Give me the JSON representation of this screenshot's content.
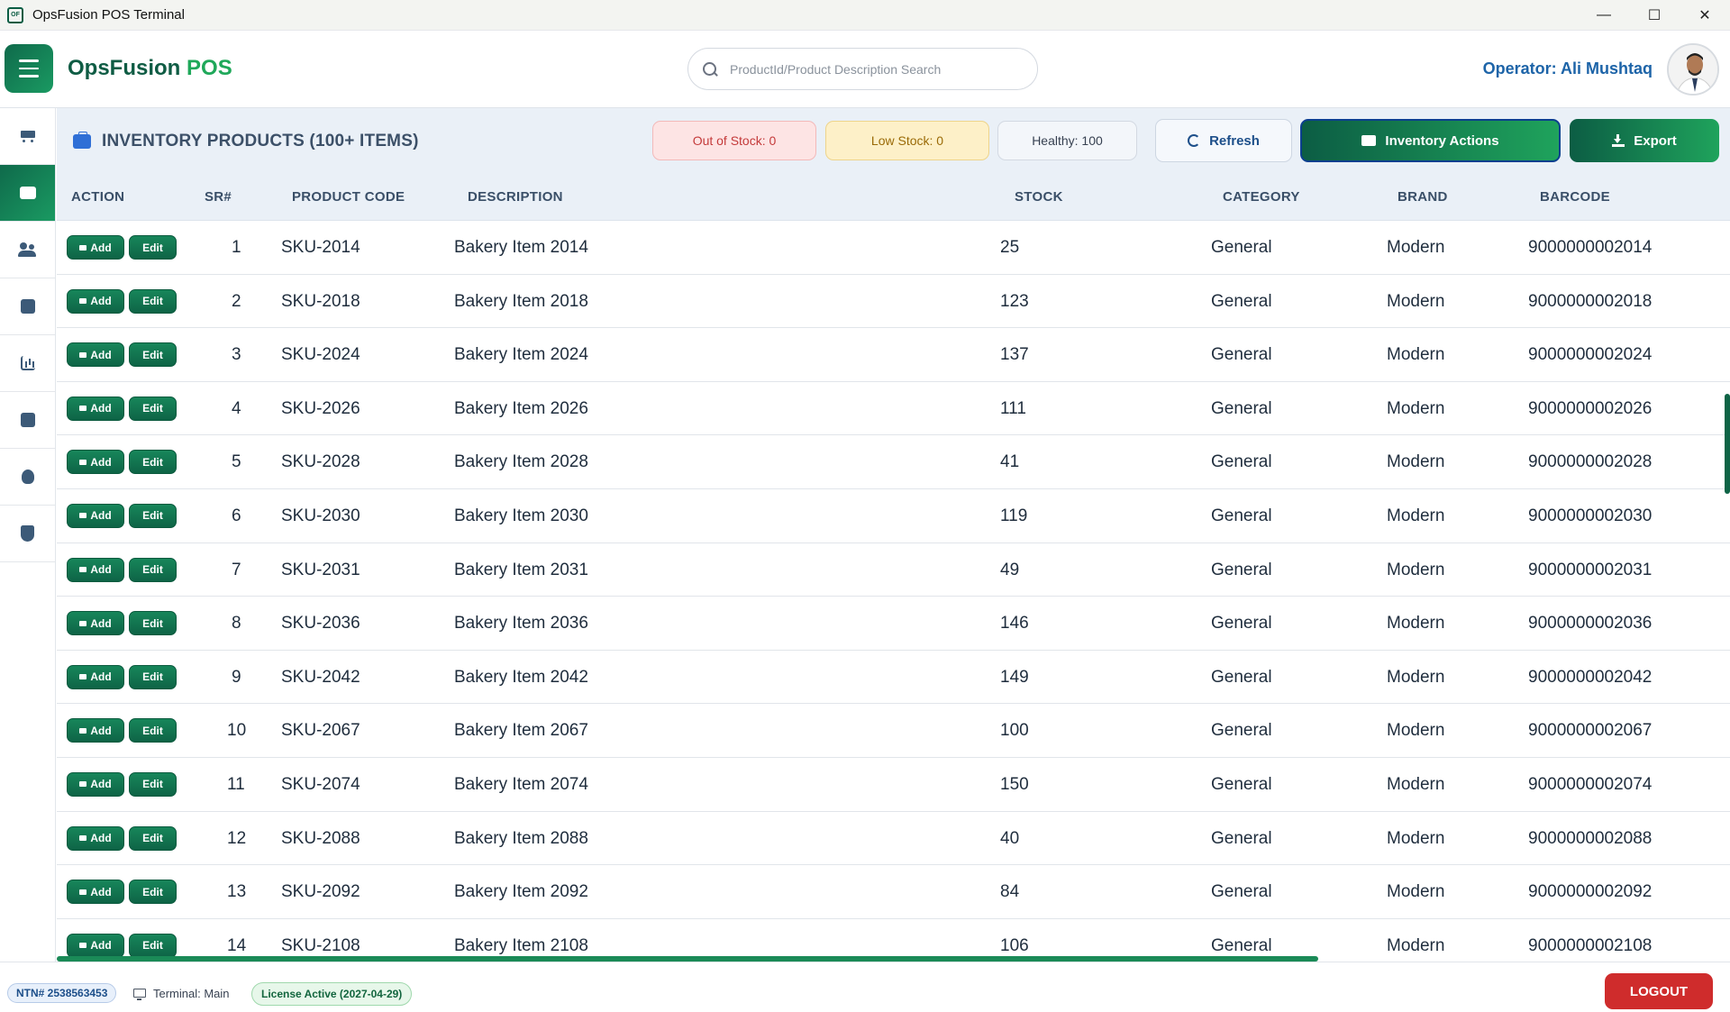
{
  "window": {
    "title": "OpsFusion POS Terminal",
    "icon_text": "OF"
  },
  "header": {
    "brand_main": "OpsFusion",
    "brand_accent": "POS",
    "search_placeholder": "ProductId/Product Description Search",
    "search_value": "",
    "operator": "Operator: Ali Mushtaq"
  },
  "sidebar": {
    "items": [
      {
        "icon": "cart-icon",
        "active": false
      },
      {
        "icon": "briefcase-icon",
        "active": true
      },
      {
        "icon": "users-icon",
        "active": false
      },
      {
        "icon": "box-icon",
        "active": false
      },
      {
        "icon": "chart-icon",
        "active": false
      },
      {
        "icon": "box-icon",
        "active": false
      },
      {
        "icon": "bulb-icon",
        "active": false
      },
      {
        "icon": "shield-icon",
        "active": false
      }
    ]
  },
  "toolbar": {
    "title": "INVENTORY PRODUCTS (100+ ITEMS)",
    "out_of_stock": "Out of Stock: 0",
    "low_stock": "Low Stock: 0",
    "healthy": "Healthy: 100",
    "refresh_label": "Refresh",
    "inventory_actions_label": "Inventory Actions",
    "export_label": "Export"
  },
  "table": {
    "columns": [
      "ACTION",
      "SR#",
      "PRODUCT CODE",
      "DESCRIPTION",
      "STOCK",
      "CATEGORY",
      "BRAND",
      "BARCODE"
    ],
    "add_label": "Add",
    "edit_label": "Edit",
    "rows": [
      {
        "sr": "1",
        "code": "SKU-2014",
        "desc": "Bakery Item 2014",
        "stock": "25",
        "category": "General",
        "brand": "Modern",
        "barcode": "9000000002014"
      },
      {
        "sr": "2",
        "code": "SKU-2018",
        "desc": "Bakery Item 2018",
        "stock": "123",
        "category": "General",
        "brand": "Modern",
        "barcode": "9000000002018"
      },
      {
        "sr": "3",
        "code": "SKU-2024",
        "desc": "Bakery Item 2024",
        "stock": "137",
        "category": "General",
        "brand": "Modern",
        "barcode": "9000000002024"
      },
      {
        "sr": "4",
        "code": "SKU-2026",
        "desc": "Bakery Item 2026",
        "stock": "111",
        "category": "General",
        "brand": "Modern",
        "barcode": "9000000002026"
      },
      {
        "sr": "5",
        "code": "SKU-2028",
        "desc": "Bakery Item 2028",
        "stock": "41",
        "category": "General",
        "brand": "Modern",
        "barcode": "9000000002028"
      },
      {
        "sr": "6",
        "code": "SKU-2030",
        "desc": "Bakery Item 2030",
        "stock": "119",
        "category": "General",
        "brand": "Modern",
        "barcode": "9000000002030"
      },
      {
        "sr": "7",
        "code": "SKU-2031",
        "desc": "Bakery Item 2031",
        "stock": "49",
        "category": "General",
        "brand": "Modern",
        "barcode": "9000000002031"
      },
      {
        "sr": "8",
        "code": "SKU-2036",
        "desc": "Bakery Item 2036",
        "stock": "146",
        "category": "General",
        "brand": "Modern",
        "barcode": "9000000002036"
      },
      {
        "sr": "9",
        "code": "SKU-2042",
        "desc": "Bakery Item 2042",
        "stock": "149",
        "category": "General",
        "brand": "Modern",
        "barcode": "9000000002042"
      },
      {
        "sr": "10",
        "code": "SKU-2067",
        "desc": "Bakery Item 2067",
        "stock": "100",
        "category": "General",
        "brand": "Modern",
        "barcode": "9000000002067"
      },
      {
        "sr": "11",
        "code": "SKU-2074",
        "desc": "Bakery Item 2074",
        "stock": "150",
        "category": "General",
        "brand": "Modern",
        "barcode": "9000000002074"
      },
      {
        "sr": "12",
        "code": "SKU-2088",
        "desc": "Bakery Item 2088",
        "stock": "40",
        "category": "General",
        "brand": "Modern",
        "barcode": "9000000002088"
      },
      {
        "sr": "13",
        "code": "SKU-2092",
        "desc": "Bakery Item 2092",
        "stock": "84",
        "category": "General",
        "brand": "Modern",
        "barcode": "9000000002092"
      },
      {
        "sr": "14",
        "code": "SKU-2108",
        "desc": "Bakery Item 2108",
        "stock": "106",
        "category": "General",
        "brand": "Modern",
        "barcode": "9000000002108"
      }
    ]
  },
  "footer": {
    "ntn": "NTN# 2538563453",
    "terminal": "Terminal: Main",
    "license": "License Active (2027-04-29)",
    "logout_label": "LOGOUT"
  },
  "colors": {
    "primary_green": "#0f6a4b",
    "accent_green": "#1fa85a",
    "operator_blue": "#1d64a8",
    "logout_red": "#cf2c2c"
  }
}
